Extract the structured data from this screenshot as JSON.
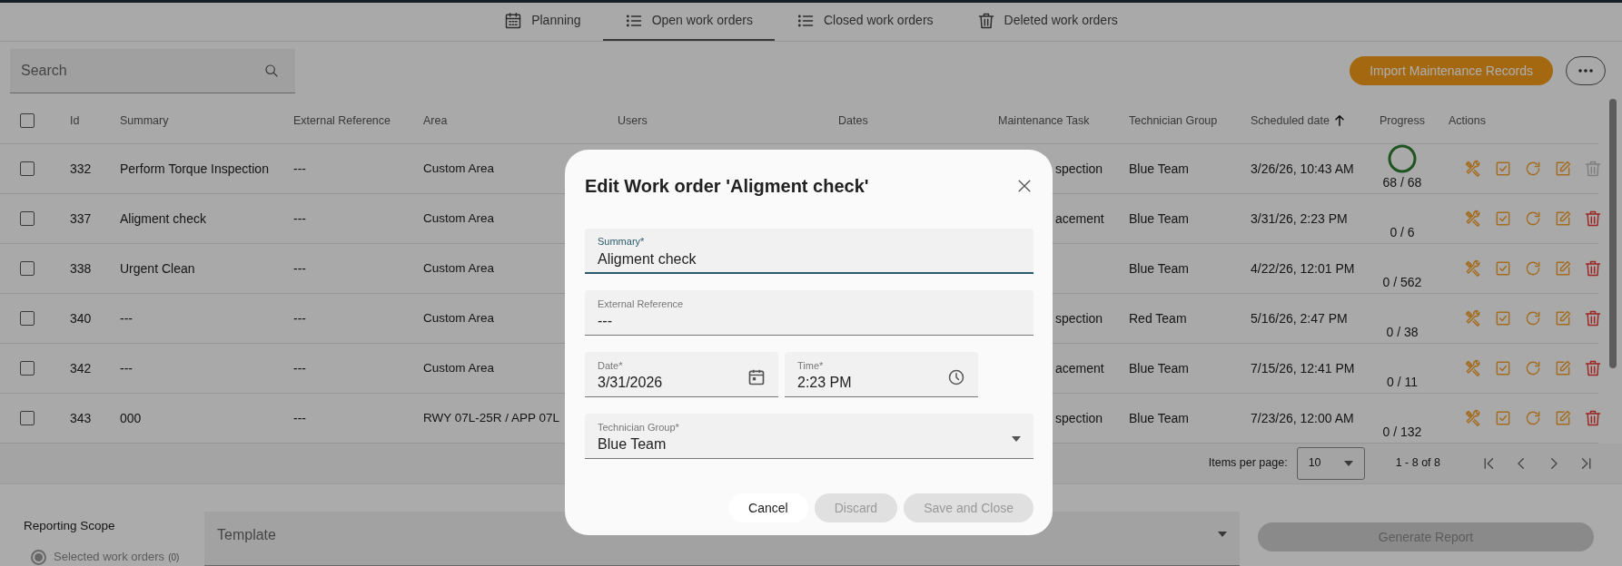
{
  "tabs": [
    {
      "label": "Planning",
      "kind": "calendar",
      "selected": false
    },
    {
      "label": "Open work orders",
      "kind": "list",
      "selected": true
    },
    {
      "label": "Closed work orders",
      "kind": "list",
      "selected": false
    },
    {
      "label": "Deleted work orders",
      "kind": "trash",
      "selected": false
    }
  ],
  "search": {
    "placeholder": "Search"
  },
  "import_button": "Import Maintenance Records",
  "table": {
    "select_all": false,
    "columns": [
      {
        "label": "Id",
        "sorted": false
      },
      {
        "label": "Summary",
        "sorted": false
      },
      {
        "label": "External Reference",
        "sorted": false
      },
      {
        "label": "Area",
        "sorted": false
      },
      {
        "label": "Users",
        "sorted": false
      },
      {
        "label": "Dates",
        "sorted": false
      },
      {
        "label": "Maintenance Task",
        "sorted": false
      },
      {
        "label": "Technician Group",
        "sorted": false
      },
      {
        "label": "Scheduled date",
        "sorted": true
      },
      {
        "label": "Progress",
        "sorted": false
      },
      {
        "label": "Actions",
        "sorted": false
      }
    ],
    "rows": [
      {
        "selected": false,
        "id": "332",
        "summary": "Perform Torque Inspection",
        "external_reference": "---",
        "area": "Custom Area",
        "maintenance_task": "spection",
        "technician_group": "Blue Team",
        "scheduled_date": "3/26/26, 10:43 AM",
        "complete": true,
        "progress": "68 / 68",
        "delete_enabled": false
      },
      {
        "selected": false,
        "id": "337",
        "summary": "Aligment check",
        "external_reference": "---",
        "area": "Custom Area",
        "maintenance_task": "acement",
        "technician_group": "Blue Team",
        "scheduled_date": "3/31/26, 2:23 PM",
        "complete": false,
        "progress": "0 / 6",
        "delete_enabled": true
      },
      {
        "selected": false,
        "id": "338",
        "summary": "Urgent Clean",
        "external_reference": "---",
        "area": "Custom Area",
        "technician_group": "Blue Team",
        "scheduled_date": "4/22/26, 12:01 PM",
        "complete": false,
        "progress": "0 / 562",
        "delete_enabled": true
      },
      {
        "selected": false,
        "id": "340",
        "summary": "---",
        "external_reference": "---",
        "area": "Custom Area",
        "maintenance_task": "spection",
        "technician_group": "Red Team",
        "scheduled_date": "5/16/26, 2:47 PM",
        "complete": false,
        "progress": "0 / 38",
        "delete_enabled": true
      },
      {
        "selected": false,
        "id": "342",
        "summary": "---",
        "external_reference": "---",
        "area": "Custom Area",
        "maintenance_task": "acement",
        "technician_group": "Blue Team",
        "scheduled_date": "7/15/26, 12:41 PM",
        "complete": false,
        "progress": "0 / 11",
        "delete_enabled": true
      },
      {
        "selected": false,
        "id": "343",
        "summary": "000",
        "external_reference": "---",
        "area": "RWY 07L-25R / APP 07L",
        "maintenance_task": "spection",
        "technician_group": "Blue Team",
        "scheduled_date": "7/23/26, 12:00 AM",
        "complete": false,
        "progress": "0 / 132",
        "delete_enabled": true
      }
    ]
  },
  "pagination": {
    "label": "Items per page:",
    "page_size": "10",
    "range": "1 - 8 of 8"
  },
  "reporting": {
    "title": "Reporting Scope",
    "options": [
      {
        "label": "Selected work orders",
        "count": "(0)",
        "selected": true
      }
    ],
    "template": {
      "placeholder": "Template"
    },
    "generate_button": {
      "label": "Generate Report",
      "disabled": true
    }
  },
  "dialog": {
    "title": "Edit Work order 'Aligment check'",
    "fields": [
      {
        "kind": "text",
        "label": "Summary*",
        "value": "Aligment check",
        "focused": true
      },
      {
        "kind": "text",
        "label": "External Reference",
        "value": "---",
        "focused": false
      },
      {
        "kind": "date",
        "label": "Date*",
        "value": "3/31/2026",
        "focused": false
      },
      {
        "kind": "time",
        "label": "Time*",
        "value": "2:23 PM",
        "focused": false
      },
      {
        "kind": "select",
        "label": "Technician Group*",
        "value": "Blue Team",
        "focused": false
      }
    ],
    "buttons": [
      {
        "label": "Cancel",
        "disabled": false
      },
      {
        "label": "Discard",
        "disabled": true
      },
      {
        "label": "Save and Close",
        "disabled": true
      }
    ]
  }
}
